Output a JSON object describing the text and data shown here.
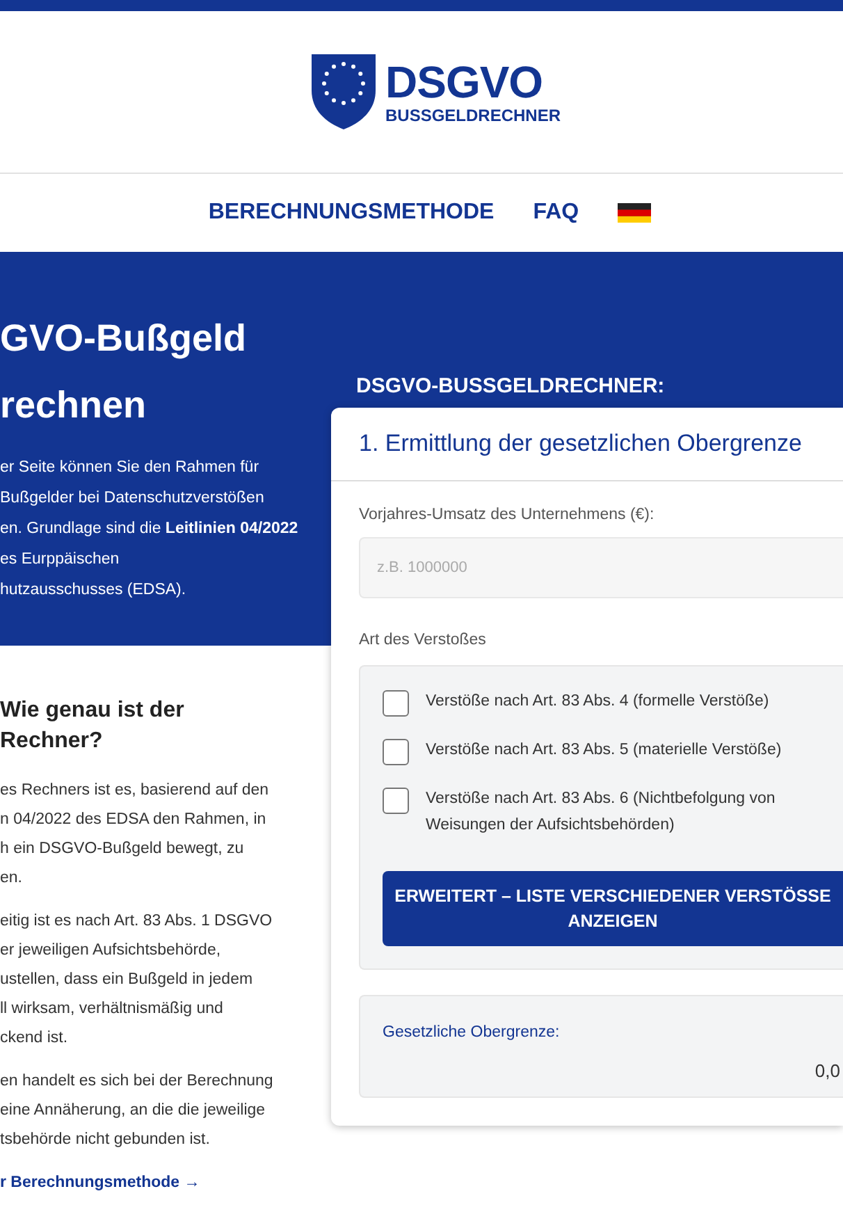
{
  "header": {
    "logo_title": "DSGVO",
    "logo_subtitle": "BUSSGELDRECHNER"
  },
  "nav": {
    "items": [
      {
        "label": "BERECHNUNGSMETHODE"
      },
      {
        "label": "FAQ"
      }
    ]
  },
  "hero": {
    "title_lines": [
      "GVO-Bußgeld",
      "rechnen"
    ],
    "paragraph_lines": [
      "er Seite können Sie den Rahmen für",
      "Bußgelder bei Datenschutzverstößen",
      "en. Grundlage sind die **Leitlinien 04/2022**",
      "es Eurppäischen",
      "hutzausschusses (EDSA)."
    ]
  },
  "info": {
    "heading_lines": [
      "Wie genau ist der",
      "Rechner?"
    ],
    "paragraphs": [
      [
        "es Rechners ist es, basierend auf den",
        "n 04/2022 des EDSA den Rahmen, in",
        "h ein DSGVO-Bußgeld bewegt, zu",
        "en."
      ],
      [
        "eitig ist es nach Art. 83 Abs. 1 DSGVO",
        "er jeweiligen Aufsichtsbehörde,",
        "ustellen, dass ein Bußgeld in jedem",
        "ll wirksam, verhältnismäßig und",
        "ckend ist."
      ],
      [
        "en handelt es sich bei der Berechnung",
        "eine Annäherung, an die die jeweilige",
        "tsbehörde nicht gebunden ist."
      ]
    ],
    "link": "r Berechnungsmethode →"
  },
  "calculator": {
    "title": "DSGVO-BUSSGELDRECHNER:",
    "card_title": "1. Ermittlung der gesetzlichen Obergrenze",
    "revenue_label": "Vorjahres-Umsatz des Unternehmens (€):",
    "revenue_placeholder": "z.B. 1000000",
    "violation_label": "Art des Verstoßes",
    "violations": [
      {
        "label": "Verstöße nach Art. 83 Abs. 4 (formelle Verstöße)",
        "checked": false
      },
      {
        "label": "Verstöße nach Art. 83 Abs. 5 (materielle Verstöße)",
        "checked": false
      },
      {
        "label": "Verstöße nach Art. 83 Abs. 6 (Nichtbefolgung von Weisungen der Aufsichtsbehörden)",
        "checked": false
      }
    ],
    "expand_button": "ERWEITERT – LISTE VERSCHIEDENER VERSTÖSSE ANZEIGEN",
    "result_label": "Gesetzliche Obergrenze:",
    "result_value": "0,0"
  }
}
